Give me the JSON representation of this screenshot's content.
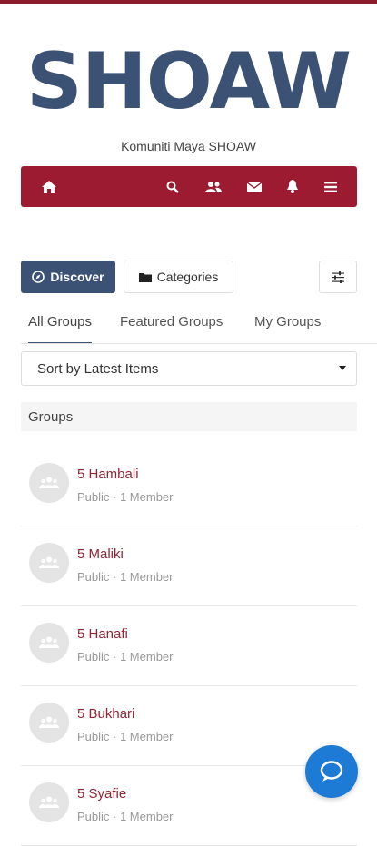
{
  "brand": {
    "logo_text": "SHOAW",
    "tagline": "Komuniti Maya SHOAW",
    "accent": "#9c1b30",
    "logo_color": "#3b5274"
  },
  "navbar": {
    "icons": [
      "home-icon",
      "search-icon",
      "users-icon",
      "mail-icon",
      "bell-icon",
      "menu-icon"
    ]
  },
  "actions": {
    "discover_label": "Discover",
    "categories_label": "Categories",
    "filter_icon": "sliders-icon"
  },
  "tabs": [
    {
      "label": "All Groups",
      "active": true
    },
    {
      "label": "Featured Groups",
      "active": false
    },
    {
      "label": "My Groups",
      "active": false
    }
  ],
  "sort": {
    "selected": "Sort by Latest Items"
  },
  "section": {
    "title": "Groups"
  },
  "groups": [
    {
      "name": "5 Hambali",
      "meta": "Public · 1 Member"
    },
    {
      "name": "5 Maliki",
      "meta": "Public · 1 Member"
    },
    {
      "name": "5 Hanafi",
      "meta": "Public · 1 Member"
    },
    {
      "name": "5 Bukhari",
      "meta": "Public · 1 Member"
    },
    {
      "name": "5 Syafie",
      "meta": "Public · 1 Member"
    }
  ],
  "chat": {
    "icon": "chat-icon",
    "color": "#1d7bd6"
  }
}
